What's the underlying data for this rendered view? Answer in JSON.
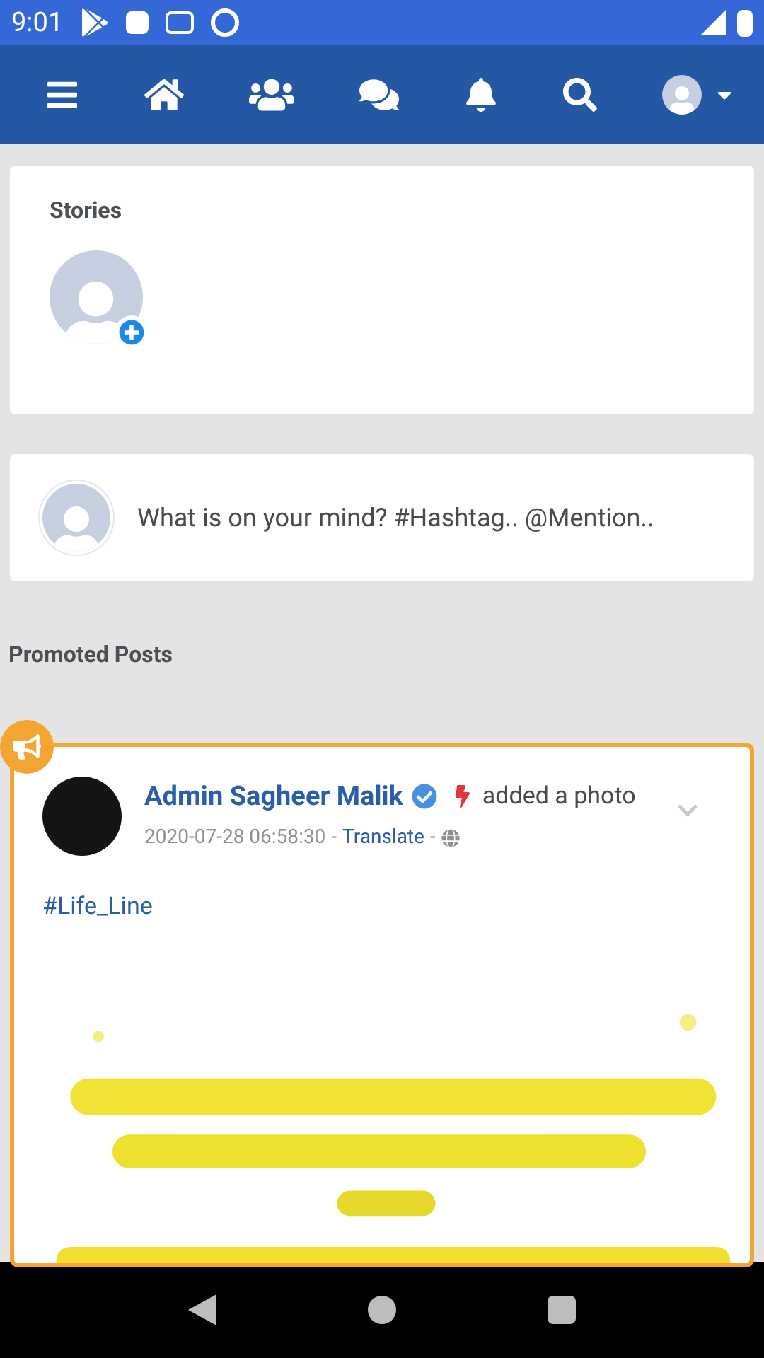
{
  "status_bar": {
    "time": "9:01"
  },
  "stories": {
    "title": "Stories"
  },
  "composer": {
    "placeholder": "What is on your mind? #Hashtag.. @Mention.."
  },
  "section_title": "Promoted Posts",
  "post": {
    "author": "Admin Sagheer Malik",
    "action": "added a photo",
    "timestamp": "2020-07-28 06:58:30",
    "separator_1": "-",
    "translate": "Translate",
    "separator_2": "-",
    "hashtag": "#Life_Line"
  }
}
